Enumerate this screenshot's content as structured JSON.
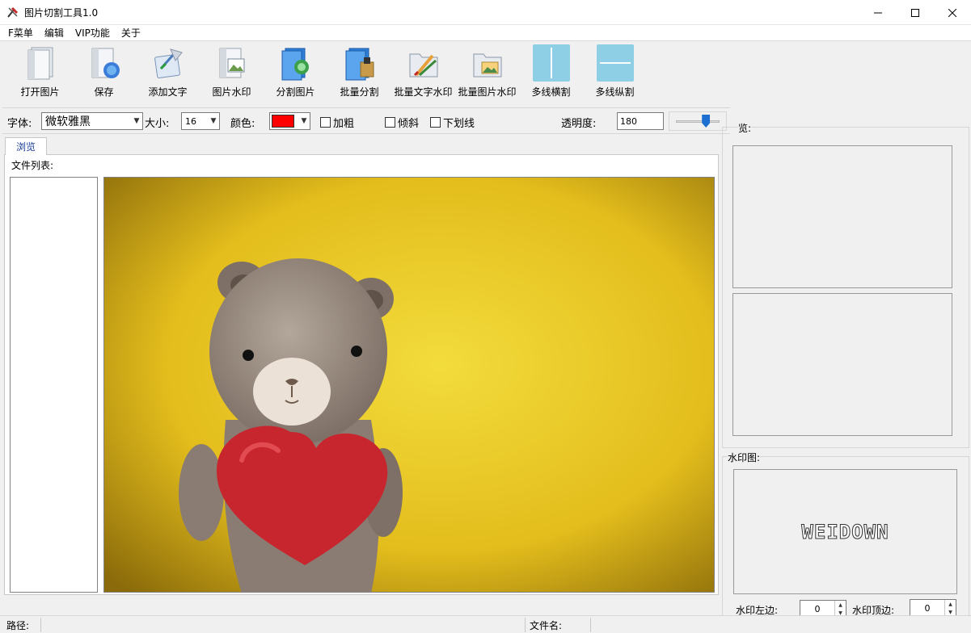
{
  "window": {
    "title": "图片切割工具1.0"
  },
  "menu": [
    "F菜单",
    "编辑",
    "VIP功能",
    "关于"
  ],
  "toolbar": [
    {
      "label": "打开图片",
      "icon": "open-image-icon"
    },
    {
      "label": "保存",
      "icon": "save-icon"
    },
    {
      "label": "添加文字",
      "icon": "add-text-icon"
    },
    {
      "label": "图片水印",
      "icon": "image-watermark-icon"
    },
    {
      "label": "分割图片",
      "icon": "split-image-icon"
    },
    {
      "label": "批量分割",
      "icon": "batch-split-icon"
    },
    {
      "label": "批量文字水印",
      "icon": "batch-text-watermark-icon"
    },
    {
      "label": "批量图片水印",
      "icon": "batch-image-watermark-icon"
    },
    {
      "label": "多线横割",
      "icon": "horizontal-lines-icon"
    },
    {
      "label": "多线纵割",
      "icon": "vertical-lines-icon"
    }
  ],
  "format": {
    "font_label": "字体:",
    "font_value": "微软雅黑",
    "size_label": "大小:",
    "size_value": "16",
    "color_label": "颜色:",
    "color_value": "#ff0000",
    "bold_label": "加粗",
    "italic_label": "倾斜",
    "underline_label": "下划线",
    "opacity_label": "透明度:",
    "opacity_value": "180",
    "opacity_slider_fraction": 0.7
  },
  "tab": {
    "label": "浏览"
  },
  "file_list_label": "文件列表:",
  "right_panel": {
    "preview_label": "览:",
    "watermark_label": "水印图:",
    "watermark_text": "WEIDOWN",
    "wm_left_label": "水印左边:",
    "wm_left_value": "0",
    "wm_top_label": "水印顶边:",
    "wm_top_value": "0"
  },
  "status": {
    "path_label": "路径:",
    "filename_label": "文件名:"
  },
  "colors": {
    "accent": "#1a3f9a",
    "tile_blue": "#8ecfe6",
    "canvas_bg": "#e8c420",
    "heart": "#c8262f"
  }
}
